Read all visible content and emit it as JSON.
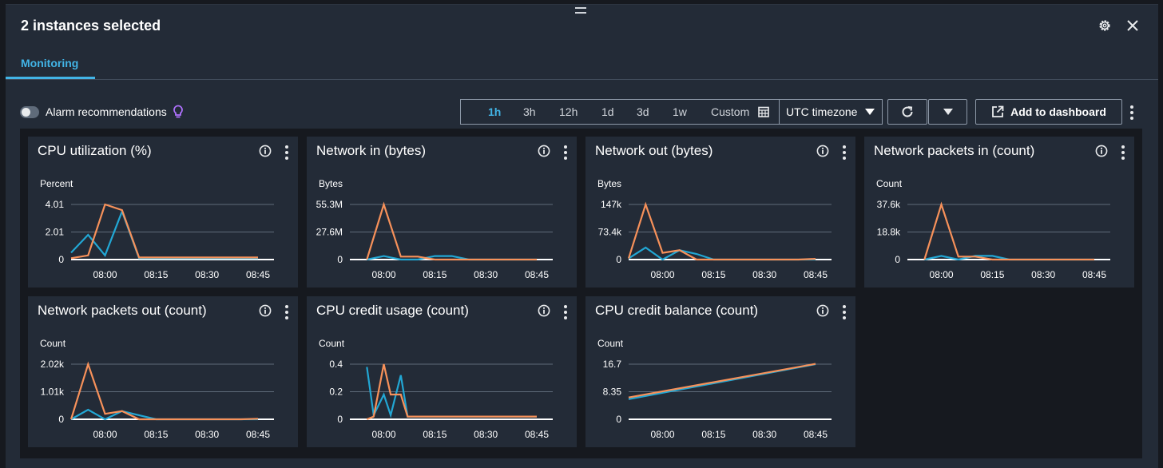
{
  "header": {
    "title": "2 instances selected"
  },
  "tabs": [
    {
      "label": "Monitoring"
    }
  ],
  "toolbar": {
    "alarm_label": "Alarm recommendations",
    "ranges": [
      "1h",
      "3h",
      "12h",
      "1d",
      "3d",
      "1w",
      "Custom"
    ],
    "active_range": "1h",
    "timezone": "UTC timezone",
    "add_to_dashboard": "Add to dashboard"
  },
  "colors": {
    "series_a": "#22a7d4",
    "series_b": "#f7915a",
    "accent": "#42b4e6"
  },
  "icons": [
    "gear-icon",
    "close-icon",
    "lightbulb-icon",
    "calendar-icon",
    "refresh-icon",
    "caret-down-icon",
    "external-link-icon",
    "info-icon",
    "kebab-icon"
  ],
  "chart_data": [
    {
      "type": "line",
      "title": "CPU utilization (%)",
      "ylabel": "Percent",
      "yticks": [
        "4.01",
        "2.01",
        "0"
      ],
      "ylim": [
        0,
        4.01
      ],
      "xticks": [
        "08:00",
        "08:15",
        "08:30",
        "08:45"
      ],
      "x": [
        "07:50",
        "07:55",
        "08:00",
        "08:05",
        "08:10",
        "08:15",
        "08:20",
        "08:25",
        "08:30",
        "08:35",
        "08:40",
        "08:45"
      ],
      "series": [
        {
          "values": [
            0.5,
            1.8,
            0.3,
            3.5,
            0.1,
            0.1,
            0.1,
            0.1,
            0.1,
            0.1,
            0.1,
            0.1
          ]
        },
        {
          "values": [
            0.1,
            0.3,
            4.01,
            3.6,
            0.15,
            0.15,
            0.15,
            0.15,
            0.15,
            0.15,
            0.15,
            0.15
          ]
        }
      ]
    },
    {
      "type": "line",
      "title": "Network in (bytes)",
      "ylabel": "Bytes",
      "yticks": [
        "55.3M",
        "27.6M",
        "0"
      ],
      "ylim": [
        0,
        55.3
      ],
      "xticks": [
        "08:00",
        "08:15",
        "08:30",
        "08:45"
      ],
      "x": [
        "07:55",
        "08:00",
        "08:05",
        "08:10",
        "08:15",
        "08:20",
        "08:25",
        "08:30",
        "08:35",
        "08:40",
        "08:45"
      ],
      "series": [
        {
          "values": [
            0,
            3.5,
            0,
            0,
            3.5,
            3.5,
            0,
            0,
            0,
            0,
            0
          ]
        },
        {
          "values": [
            0,
            55.3,
            3,
            3,
            0,
            0,
            0,
            0,
            0,
            0,
            0
          ]
        }
      ]
    },
    {
      "type": "line",
      "title": "Network out (bytes)",
      "ylabel": "Bytes",
      "yticks": [
        "147k",
        "73.4k",
        "0"
      ],
      "ylim": [
        0,
        147
      ],
      "xticks": [
        "08:00",
        "08:15",
        "08:30",
        "08:45"
      ],
      "x": [
        "07:50",
        "07:55",
        "08:00",
        "08:05",
        "08:10",
        "08:15",
        "08:20",
        "08:25",
        "08:30",
        "08:35",
        "08:40",
        "08:45"
      ],
      "series": [
        {
          "values": [
            3,
            32,
            0,
            25,
            15,
            0,
            0,
            0,
            0,
            0,
            0,
            0
          ]
        },
        {
          "values": [
            3,
            147,
            18,
            25,
            0,
            0,
            0,
            0,
            0,
            0,
            0,
            2
          ]
        }
      ]
    },
    {
      "type": "line",
      "title": "Network packets in (count)",
      "ylabel": "Count",
      "yticks": [
        "37.6k",
        "18.8k",
        "0"
      ],
      "ylim": [
        0,
        37.6
      ],
      "xticks": [
        "08:00",
        "08:15",
        "08:30",
        "08:45"
      ],
      "x": [
        "07:55",
        "08:00",
        "08:05",
        "08:10",
        "08:15",
        "08:20",
        "08:25",
        "08:30",
        "08:35",
        "08:40",
        "08:45"
      ],
      "series": [
        {
          "values": [
            0,
            2.5,
            0,
            2.5,
            2.5,
            0,
            0,
            0,
            0,
            0,
            0
          ]
        },
        {
          "values": [
            0,
            37.6,
            2,
            2,
            0,
            0,
            0,
            0,
            0,
            0,
            0
          ]
        }
      ]
    },
    {
      "type": "line",
      "title": "Network packets out (count)",
      "ylabel": "Count",
      "yticks": [
        "2.02k",
        "1.01k",
        "0"
      ],
      "ylim": [
        0,
        2.02
      ],
      "xticks": [
        "08:00",
        "08:15",
        "08:30",
        "08:45"
      ],
      "x": [
        "07:50",
        "07:55",
        "08:00",
        "08:05",
        "08:10",
        "08:15",
        "08:20",
        "08:25",
        "08:30",
        "08:35",
        "08:40",
        "08:45"
      ],
      "series": [
        {
          "values": [
            0,
            0.35,
            0,
            0.3,
            0.15,
            0,
            0,
            0,
            0,
            0,
            0,
            0
          ]
        },
        {
          "values": [
            0,
            2.02,
            0.2,
            0.3,
            0,
            0,
            0,
            0,
            0,
            0,
            0,
            0.02
          ]
        }
      ]
    },
    {
      "type": "line",
      "title": "CPU credit usage (count)",
      "ylabel": "Count",
      "yticks": [
        "0.4",
        "0.2",
        "0"
      ],
      "ylim": [
        0,
        0.4
      ],
      "xticks": [
        "08:00",
        "08:15",
        "08:30",
        "08:45"
      ],
      "x": [
        "07:55",
        "07:57",
        "08:00",
        "08:02",
        "08:05",
        "08:07",
        "08:10",
        "08:15",
        "08:20",
        "08:25",
        "08:30",
        "08:35",
        "08:40",
        "08:45"
      ],
      "series": [
        {
          "values": [
            0.38,
            0.03,
            0.18,
            0.03,
            0.32,
            0.02,
            0.02,
            0.02,
            0.02,
            0.02,
            0.02,
            0.02,
            0.02,
            0.02
          ]
        },
        {
          "values": [
            0,
            0.02,
            0.4,
            0.18,
            0.18,
            0.02,
            0.02,
            0.02,
            0.02,
            0.02,
            0.02,
            0.02,
            0.02,
            0.02
          ]
        }
      ]
    },
    {
      "type": "line",
      "title": "CPU credit balance (count)",
      "ylabel": "Count",
      "yticks": [
        "16.7",
        "8.35",
        "0"
      ],
      "ylim": [
        0,
        16.7
      ],
      "xticks": [
        "08:00",
        "08:15",
        "08:30",
        "08:45"
      ],
      "x": [
        "07:50",
        "08:45"
      ],
      "series": [
        {
          "values": [
            6.1,
            16.7
          ]
        },
        {
          "values": [
            6.6,
            16.8
          ]
        }
      ]
    }
  ]
}
